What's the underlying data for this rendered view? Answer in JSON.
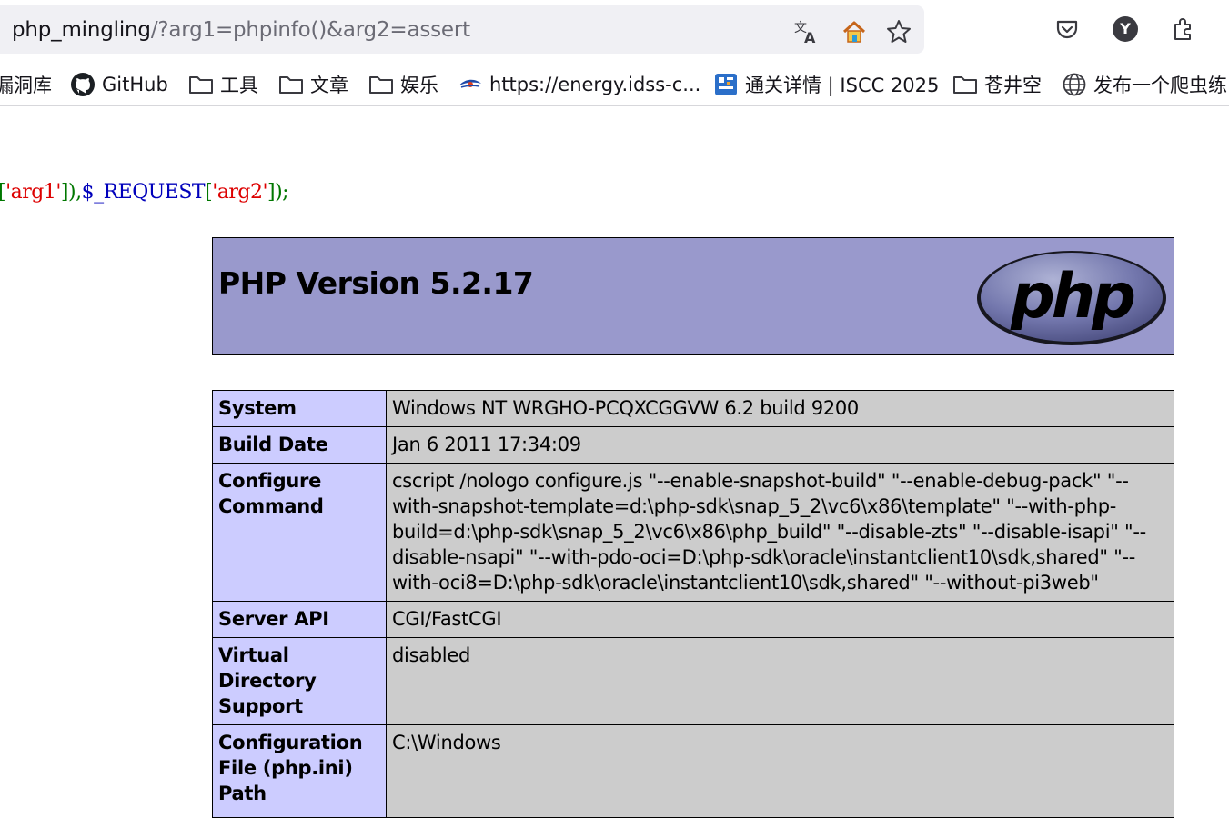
{
  "browser": {
    "url_host": "php_mingling",
    "url_path": "/?arg1=phpinfo()&arg2=assert",
    "profile_initial": "Y",
    "bookmarks": [
      {
        "label": "漏洞库",
        "icon": "none"
      },
      {
        "label": "GitHub",
        "icon": "github-icon"
      },
      {
        "label": "工具",
        "icon": "folder-icon"
      },
      {
        "label": "文章",
        "icon": "folder-icon"
      },
      {
        "label": "娱乐",
        "icon": "folder-icon"
      },
      {
        "label": "https://energy.idss-c...",
        "icon": "eye-logo-icon"
      },
      {
        "label": "通关详情 | ISCC 2025",
        "icon": "iscc-icon"
      },
      {
        "label": "苍井空",
        "icon": "folder-icon"
      },
      {
        "label": "发布一个爬虫练",
        "icon": "globe-icon"
      }
    ]
  },
  "code": {
    "p1": "[",
    "s1": "'arg1'",
    "p2": "]),",
    "v1": "$_REQUEST",
    "p3": "[",
    "s2": "'arg2'",
    "p4": "]);"
  },
  "phpinfo": {
    "title": "PHP Version 5.2.17",
    "logo_text": "php",
    "rows": [
      {
        "key": "System",
        "value": "Windows NT WRGHO-PCQXCGGVW 6.2 build 9200"
      },
      {
        "key": "Build Date",
        "value": "Jan 6 2011 17:34:09"
      },
      {
        "key": "Configure Command",
        "value": "cscript /nologo configure.js \"--enable-snapshot-build\" \"--enable-debug-pack\" \"--with-snapshot-template=d:\\php-sdk\\snap_5_2\\vc6\\x86\\template\" \"--with-php-build=d:\\php-sdk\\snap_5_2\\vc6\\x86\\php_build\" \"--disable-zts\" \"--disable-isapi\" \"--disable-nsapi\" \"--with-pdo-oci=D:\\php-sdk\\oracle\\instantclient10\\sdk,shared\" \"--with-oci8=D:\\php-sdk\\oracle\\instantclient10\\sdk,shared\" \"--without-pi3web\""
      },
      {
        "key": "Server API",
        "value": "CGI/FastCGI"
      },
      {
        "key": "Virtual Directory Support",
        "value": "disabled"
      },
      {
        "key": "Configuration File (php.ini) Path",
        "value": "C:\\Windows"
      }
    ]
  },
  "colors": {
    "header_bg": "#9999cc",
    "key_bg": "#ccccff",
    "value_bg": "#cccccc"
  }
}
